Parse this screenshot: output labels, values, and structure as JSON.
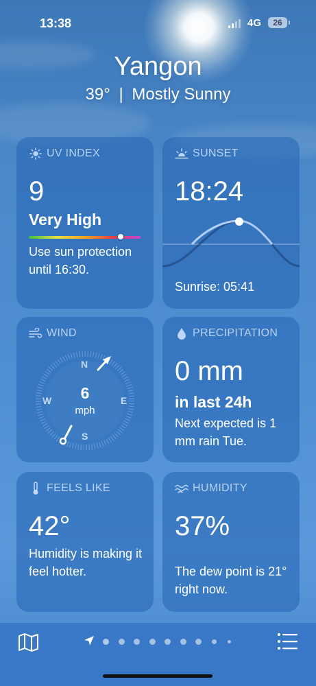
{
  "status_bar": {
    "time": "13:38",
    "network": "4G",
    "battery": "26"
  },
  "location": {
    "city": "Yangon",
    "temperature": "39°",
    "separator": "|",
    "condition": "Mostly Sunny"
  },
  "uv_index": {
    "title": "UV INDEX",
    "icon": "sun-icon",
    "value": "9",
    "level": "Very High",
    "level_fraction": 0.82,
    "description": "Use sun protection until 16:30."
  },
  "sunset": {
    "title": "SUNSET",
    "icon": "sunset-icon",
    "time": "18:24",
    "sunrise": "Sunrise: 05:41"
  },
  "wind": {
    "title": "WIND",
    "icon": "wind-icon",
    "speed": "6",
    "unit": "mph",
    "directions": {
      "n": "N",
      "e": "E",
      "s": "S",
      "w": "W"
    }
  },
  "precipitation": {
    "title": "PRECIPITATION",
    "icon": "raindrop-icon",
    "amount": "0 mm",
    "period": "in last 24h",
    "description": "Next expected is 1 mm rain Tue."
  },
  "feels_like": {
    "title": "FEELS LIKE",
    "icon": "thermometer-icon",
    "value": "42°",
    "description": "Humidity is making it feel hotter."
  },
  "humidity": {
    "title": "HUMIDITY",
    "icon": "humidity-icon",
    "value": "37%",
    "description": "The dew point is 21° right now."
  },
  "bottom_bar": {
    "map_icon": "map-icon",
    "list_icon": "list-icon",
    "location_icon": "location-arrow-icon",
    "page_count": 9,
    "current_page": 0
  },
  "colors": {
    "sky": "#4f8fd3",
    "card": "#2464b2",
    "sun_dot": "#ffffff",
    "uv_gradient": [
      "#3ec142",
      "#e8e045",
      "#f4a623",
      "#e2403d",
      "#c844d8"
    ]
  }
}
